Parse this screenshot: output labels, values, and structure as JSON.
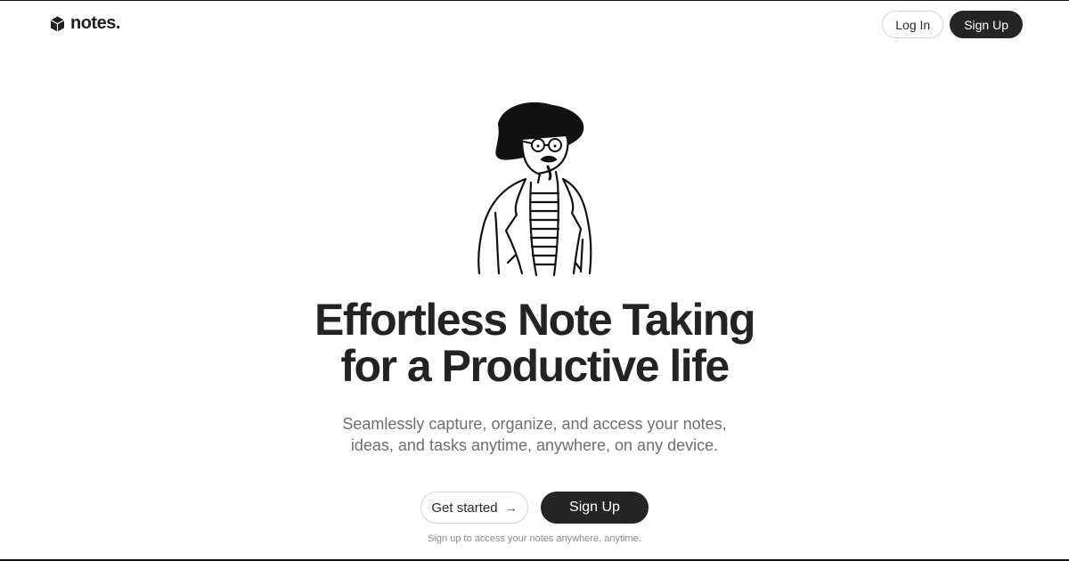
{
  "nav": {
    "logo_text": "notes.",
    "logo_icon": "cube-icon",
    "login_label": "Log In",
    "signup_label": "Sign Up"
  },
  "hero": {
    "illustration": "man-with-hat-illustration",
    "headline_line1": "Effortless Note Taking",
    "headline_line2": "for a Productive life",
    "subtitle_line1": "Seamlessly capture, organize, and access your notes,",
    "subtitle_line2": "ideas, and tasks anytime, anywhere, on any device.",
    "get_started_label": "Get started",
    "get_started_icon": "arrow-right-icon",
    "signup_label": "Sign Up",
    "note": "Sign up to access your notes anywhere, anytime."
  },
  "colors": {
    "dark_button": "#252525",
    "text": "#232323",
    "muted_text": "#6f6f6f"
  }
}
